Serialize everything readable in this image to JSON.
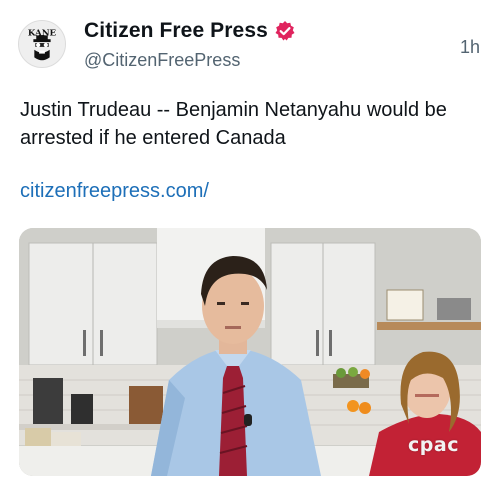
{
  "author": {
    "display_name": "Citizen Free Press",
    "handle": "@CitizenFreePress",
    "avatar_text": "KANE",
    "verified": true
  },
  "timestamp": "1h",
  "post": {
    "text": "Justin Trudeau -- Benjamin Netanyahu would be arrested if he entered Canada",
    "link_text": "citizenfreepress.com/"
  },
  "media": {
    "watermark": "cpac"
  },
  "colors": {
    "verified_badge": "#e0245e",
    "link": "#1d6fb8",
    "secondary_text": "#536471"
  }
}
